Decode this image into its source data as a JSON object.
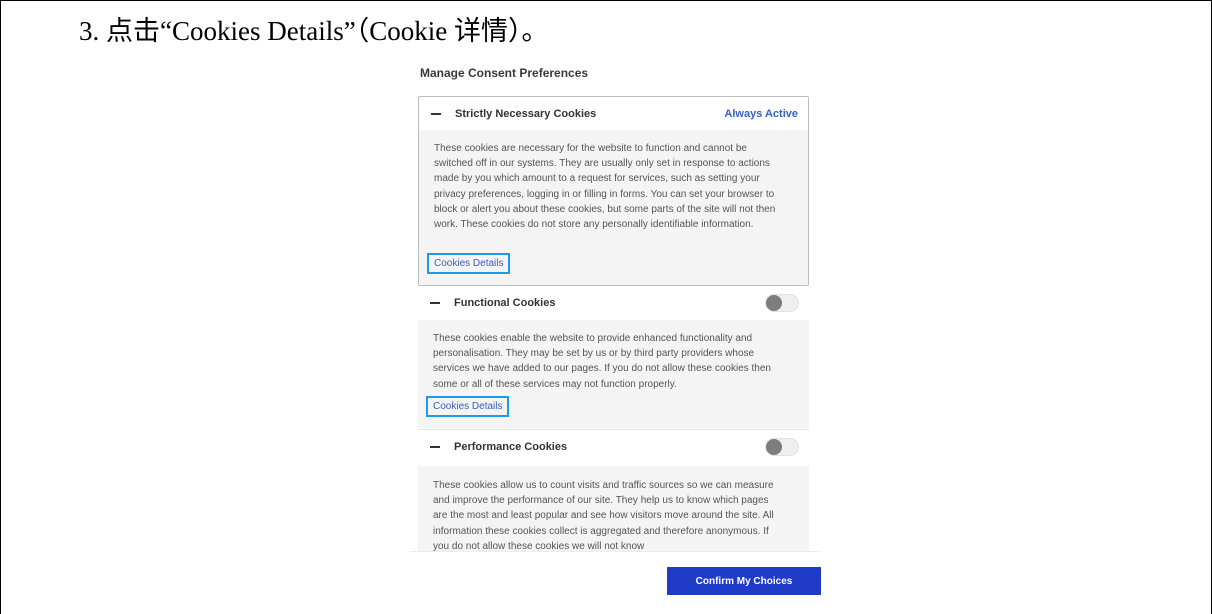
{
  "heading": "3.  点击“Cookies Details”（Cookie 详情）。",
  "panel_title": "Manage Consent Preferences",
  "groups": [
    {
      "title": "Strictly Necessary Cookies",
      "status": "Always Active",
      "description": "These cookies are necessary for the website to function and cannot be switched off in our systems. They are usually only set in response to actions made by you which amount to a request for services, such as setting your privacy preferences, logging in or filling in forms. You can set your browser to block or alert you about these cookies, but some parts of the site will not then work. These cookies do not store any personally identifiable information.",
      "link": "Cookies Details"
    },
    {
      "title": "Functional Cookies",
      "toggle": "off",
      "description": "These cookies enable the website to provide enhanced functionality and personalisation. They may be set by us or by third party providers whose services we have added to our pages. If you do not allow these cookies then some or all of these services may not function properly.",
      "link": "Cookies Details"
    },
    {
      "title": "Performance Cookies",
      "toggle": "off",
      "description": "These cookies allow us to count visits and traffic sources so we can measure and improve the performance of our site. They help us to know which pages are the most and least popular and see how visitors move around the site. All information these cookies collect is aggregated and therefore anonymous. If you do not allow these cookies we will not know"
    }
  ],
  "confirm_button": "Confirm My Choices",
  "colors": {
    "accent": "#3860be",
    "button": "#1f3bc7",
    "highlight": "#1c9ce8"
  },
  "icons": [
    "collapse-icon",
    "toggle-switch"
  ]
}
